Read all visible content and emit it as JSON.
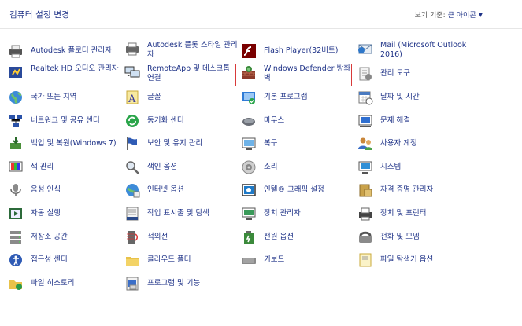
{
  "header": {
    "title": "컴퓨터 설정 변경",
    "view_by_label": "보기 기준:",
    "view_by_value": "큰 아이콘"
  },
  "items": [
    {
      "label": "Autodesk 플로터 관리자",
      "icon": "plotter-manager-icon"
    },
    {
      "label": "Autodesk 플롯 스타일 관리자",
      "icon": "plot-style-manager-icon"
    },
    {
      "label": "Flash Player(32비트)",
      "icon": "flash-player-icon"
    },
    {
      "label": "Mail (Microsoft Outlook 2016)",
      "icon": "mail-icon"
    },
    {
      "label": "Realtek HD 오디오 관리자",
      "icon": "realtek-audio-icon"
    },
    {
      "label": "RemoteApp 및 데스크톱 연결",
      "icon": "remote-desktop-icon"
    },
    {
      "label": "Windows Defender 방화벽",
      "icon": "firewall-icon"
    },
    {
      "label": "관리 도구",
      "icon": "admin-tools-icon"
    },
    {
      "label": "국가 또는 지역",
      "icon": "region-globe-icon"
    },
    {
      "label": "글꼴",
      "icon": "fonts-icon"
    },
    {
      "label": "기본 프로그램",
      "icon": "default-programs-icon"
    },
    {
      "label": "날짜 및 시간",
      "icon": "date-time-icon"
    },
    {
      "label": "네트워크 및 공유 센터",
      "icon": "network-sharing-icon"
    },
    {
      "label": "동기화 센터",
      "icon": "sync-center-icon"
    },
    {
      "label": "마우스",
      "icon": "mouse-icon"
    },
    {
      "label": "문제 해결",
      "icon": "troubleshooting-icon"
    },
    {
      "label": "백업 및 복원(Windows 7)",
      "icon": "backup-restore-icon"
    },
    {
      "label": "보안 및 유지 관리",
      "icon": "security-flag-icon"
    },
    {
      "label": "복구",
      "icon": "recovery-icon"
    },
    {
      "label": "사용자 계정",
      "icon": "user-accounts-icon"
    },
    {
      "label": "색 관리",
      "icon": "color-management-icon"
    },
    {
      "label": "색인 옵션",
      "icon": "indexing-options-icon"
    },
    {
      "label": "소리",
      "icon": "sound-icon"
    },
    {
      "label": "시스템",
      "icon": "system-icon"
    },
    {
      "label": "음성 인식",
      "icon": "speech-recognition-icon"
    },
    {
      "label": "인터넷 옵션",
      "icon": "internet-options-icon"
    },
    {
      "label": "인텔® 그래픽 설정",
      "icon": "intel-graphics-icon"
    },
    {
      "label": "자격 증명 관리자",
      "icon": "credential-manager-icon"
    },
    {
      "label": "자동 실행",
      "icon": "autoplay-icon"
    },
    {
      "label": "작업 표시줄 및 탐색",
      "icon": "taskbar-icon"
    },
    {
      "label": "장치 관리자",
      "icon": "device-manager-icon"
    },
    {
      "label": "장치 및 프린터",
      "icon": "devices-printers-icon"
    },
    {
      "label": "저장소 공간",
      "icon": "storage-spaces-icon"
    },
    {
      "label": "적외선",
      "icon": "infrared-icon"
    },
    {
      "label": "전원 옵션",
      "icon": "power-options-icon"
    },
    {
      "label": "전화 및 모뎀",
      "icon": "phone-modem-icon"
    },
    {
      "label": "접근성 센터",
      "icon": "ease-of-access-icon"
    },
    {
      "label": "클라우드 폴더",
      "icon": "work-folders-icon"
    },
    {
      "label": "키보드",
      "icon": "keyboard-icon"
    },
    {
      "label": "파일 탐색기 옵션",
      "icon": "file-explorer-options-icon"
    },
    {
      "label": "파일 히스토리",
      "icon": "file-history-icon"
    },
    {
      "label": "프로그램 및 기능",
      "icon": "programs-features-icon"
    }
  ],
  "highlighted_item": "Windows Defender 방화벽",
  "colors": {
    "link": "#1e3287",
    "highlight_border": "#d83a3a"
  }
}
